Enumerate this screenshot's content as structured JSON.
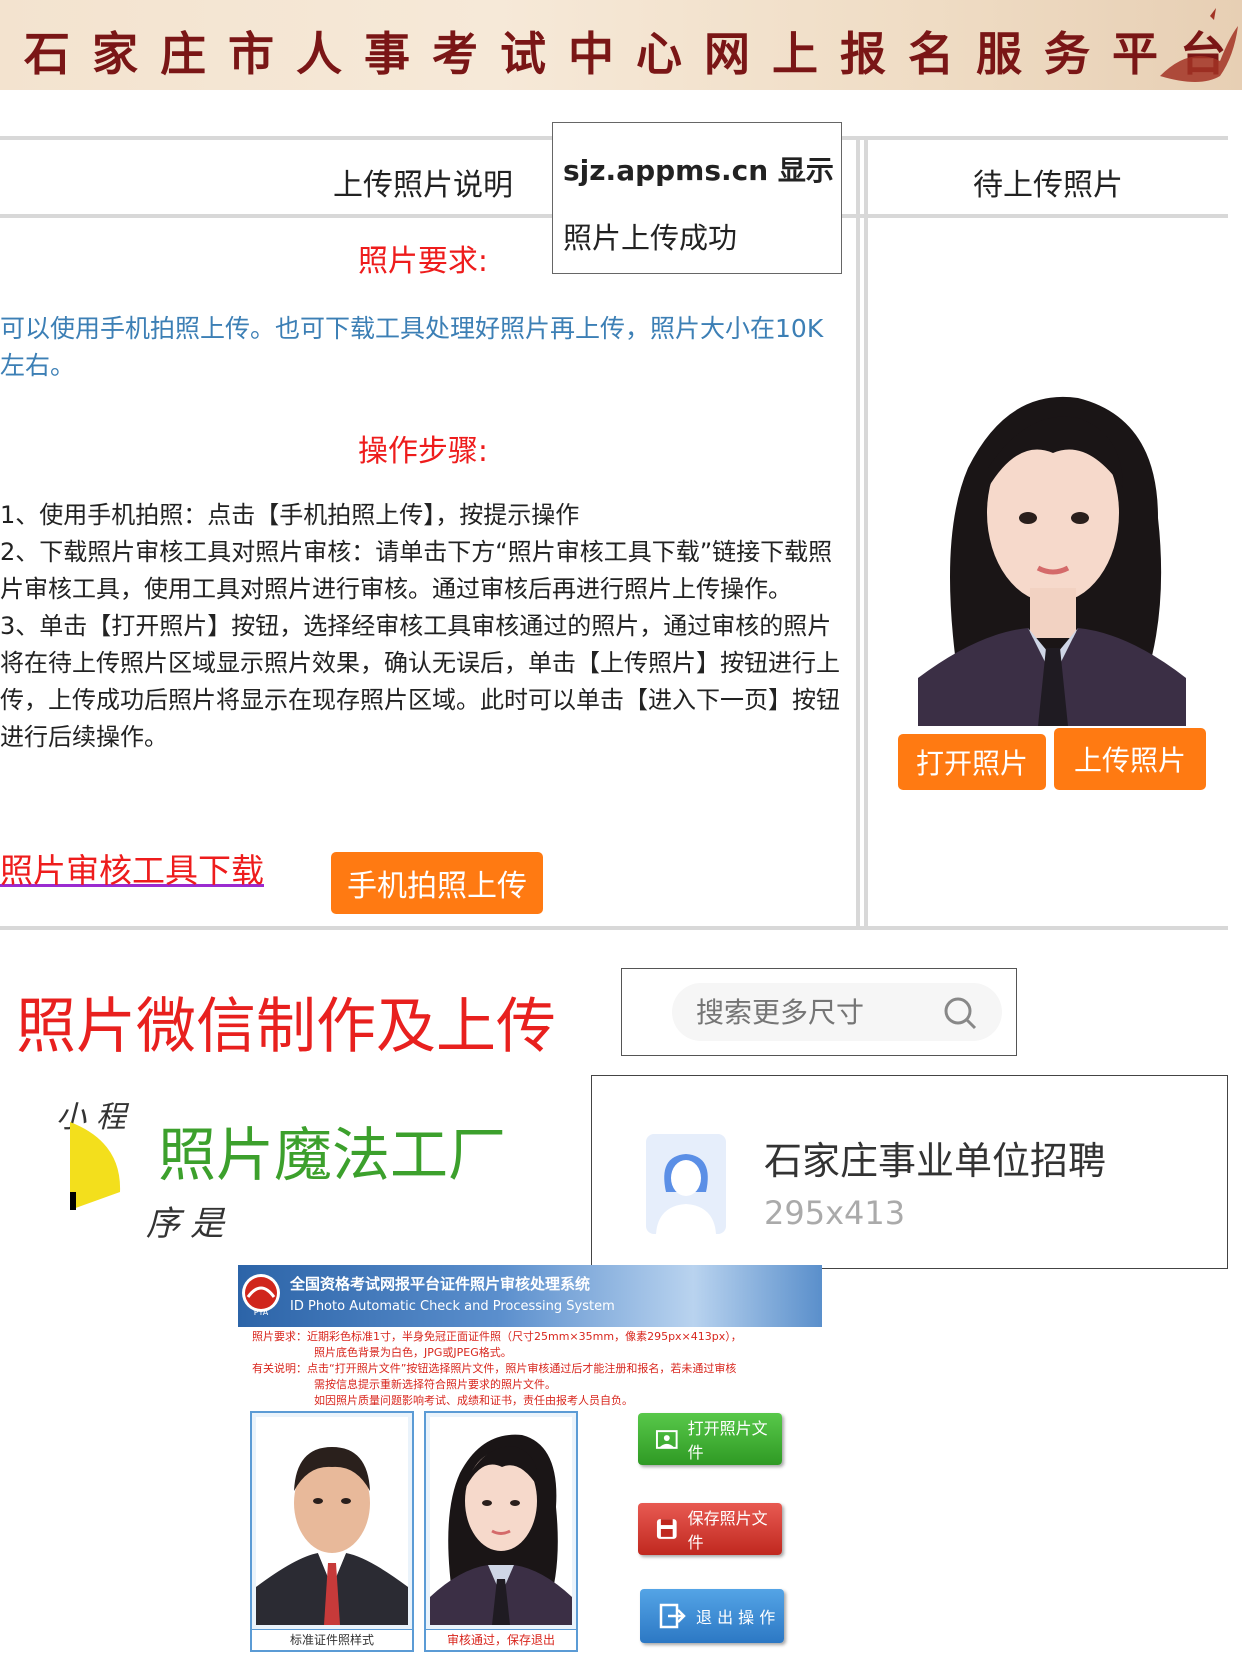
{
  "header": {
    "title": "石家庄市人事考试中心网上报名服务平台"
  },
  "table": {
    "left_header": "上传照片说明",
    "right_header": "待上传照片",
    "requirements_heading": "照片要求:",
    "requirements_text": "可以使用手机拍照上传。也可下载工具处理好照片再上传，照片大小在10K左右。",
    "steps_heading": "操作步骤:",
    "steps": [
      "1、使用手机拍照：点击【手机拍照上传】，按提示操作",
      "2、下载照片审核工具对照片审核：请单击下方“照片审核工具下载”链接下载照片审核工具，使用工具对照片进行审核。通过审核后再进行照片上传操作。",
      "3、单击【打开照片】按钮，选择经审核工具审核通过的照片，通过审核的照片将在待上传照片区域显示照片效果，确认无误后，单击【上传照片】按钮进行上传，上传成功后照片将显示在现存照片区域。此时可以单击【进入下一页】按钮进行后续操作。"
    ],
    "download_link": "照片审核工具下载",
    "mobile_upload_button": "手机拍照上传",
    "open_photo_button": "打开照片",
    "upload_photo_button": "上传照片"
  },
  "dialog": {
    "site": "sjz.appms.cn 显示",
    "message": "照片上传成功"
  },
  "promo": {
    "headline": "照片微信制作及上传",
    "miniapp_prefix": "小程",
    "miniapp_suffix": "序是",
    "miniapp_name": "照片魔法工厂"
  },
  "search": {
    "placeholder": "搜索更多尺寸"
  },
  "size_card": {
    "title": "石家庄事业单位招聘",
    "size": "295x413"
  },
  "tool": {
    "title_cn": "全国资格考试网报平台证件照片审核处理系统",
    "title_en": "ID Photo Automatic Check and Processing System",
    "logo_text": "PTA",
    "req_label": "照片要求：",
    "req_line1": "近期彩色标准1寸，半身免冠正面证件照（尺寸25mm×35mm，像素295px×413px），",
    "req_line2": "照片底色背景为白色，JPG或JPEG格式。",
    "note_label": "有关说明：",
    "note_line1": "点击“打开照片文件”按钮选择照片文件，照片审核通过后才能注册和报名，若未通过审核",
    "note_line2": "需按信息提示重新选择符合照片要求的照片文件。",
    "note_line3": "如因照片质量问题影响考试、成绩和证书，责任由报考人员自负。",
    "sample_caption": "标准证件照样式",
    "result_caption": "审核通过，保存退出",
    "open_button": "打开照片文件",
    "save_button": "保存照片文件",
    "exit_button": "退 出 操 作"
  },
  "colors": {
    "accent_orange": "#ff7a12",
    "red": "#ee1c1c",
    "banner_text": "#7a1616"
  }
}
